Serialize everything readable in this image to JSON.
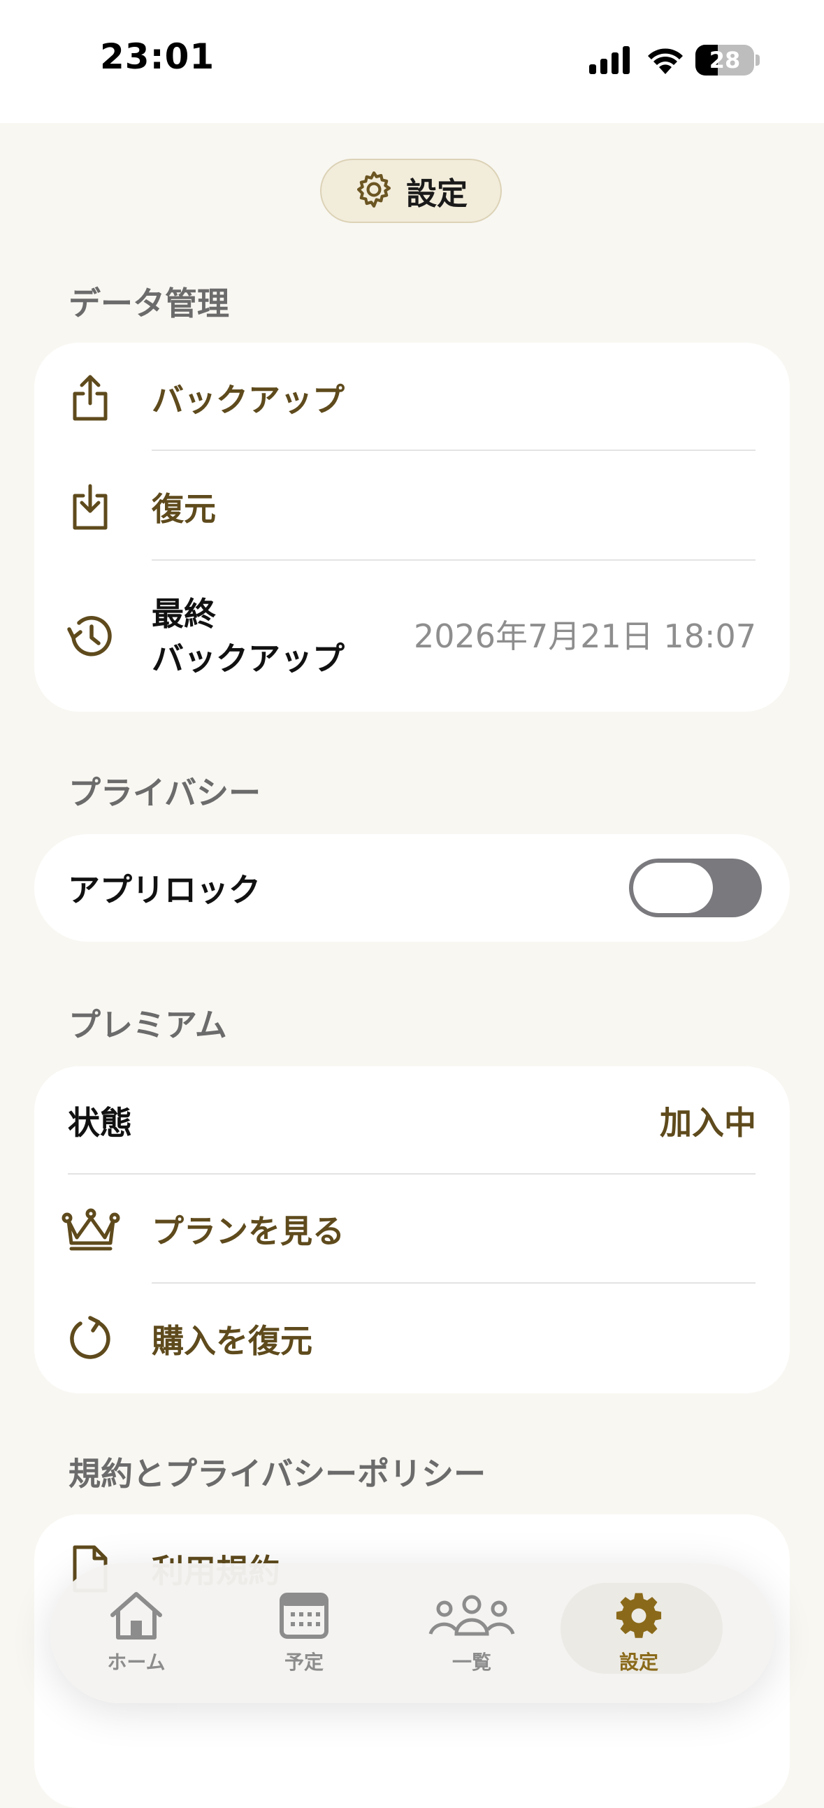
{
  "status_bar": {
    "time": "23:01",
    "battery": "28"
  },
  "header": {
    "title": "設定",
    "icon": "gear-icon"
  },
  "data_section": {
    "label": "データ管理",
    "backup_label": "バックアップ",
    "restore_label": "復元",
    "last_backup_label_1": "最終",
    "last_backup_label_2": "バックアップ",
    "last_backup_value": "2026年7月21日 18:07"
  },
  "privacy_section": {
    "label": "プライバシー",
    "app_lock_label": "アプリロック",
    "app_lock_on": false
  },
  "premium_section": {
    "label": "プレミアム",
    "status_label": "状態",
    "status_value": "加入中",
    "view_plans_label": "プランを見る",
    "restore_purchase_label": "購入を復元"
  },
  "terms_section": {
    "label": "規約とプライバシーポリシー",
    "terms_label": "利用規約"
  },
  "tab_bar": {
    "tabs": [
      {
        "label": "ホーム",
        "icon": "home-icon"
      },
      {
        "label": "予定",
        "icon": "calendar-icon"
      },
      {
        "label": "一覧",
        "icon": "people-icon"
      },
      {
        "label": "設定",
        "icon": "gear-icon",
        "active": true
      }
    ]
  },
  "colors": {
    "background": "#F8F7F2",
    "accent_brown": "#5E4A1C",
    "tab_active": "#8A6A1A",
    "section_label": "#6B6B6B"
  }
}
